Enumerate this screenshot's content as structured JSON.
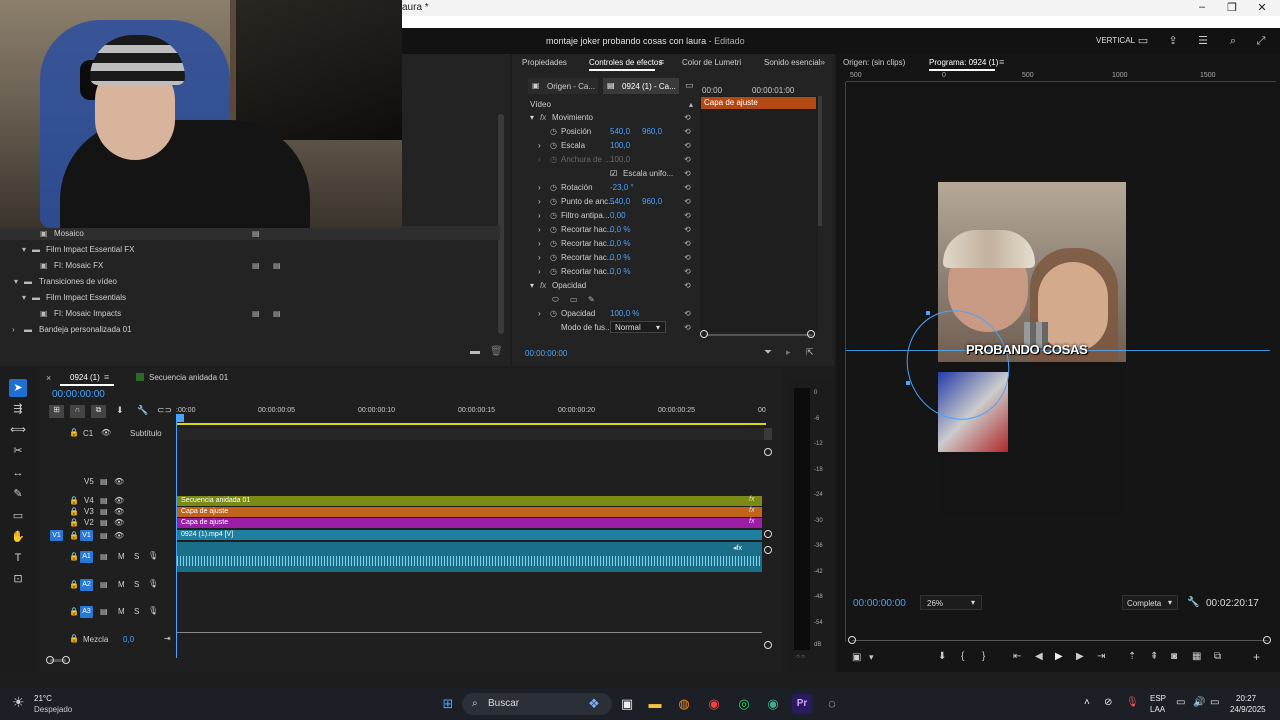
{
  "window": {
    "title_fragment": "aura *"
  },
  "header": {
    "project_title": "montaje joker probando cosas con laura",
    "edited_suffix": " - Editado",
    "workspace": "VERTICAL"
  },
  "bin": {
    "items": [
      {
        "label": "Mosaico",
        "icon": "effect-icon"
      },
      {
        "label": "Film Impact Essential FX",
        "icon": "folder-icon"
      },
      {
        "label": "FI: Mosaic FX",
        "icon": "effect-icon"
      },
      {
        "label": "Transiciones de vídeo",
        "icon": "folder-icon"
      },
      {
        "label": "Film Impact Essentials",
        "icon": "folder-icon"
      },
      {
        "label": "FI: Mosaic Impacts",
        "icon": "effect-icon"
      },
      {
        "label": "Bandeja personalizada 01",
        "icon": "folder-icon"
      }
    ]
  },
  "effects": {
    "tabs": [
      "Propiedades",
      "Controles de efectos",
      "Color de Lumetri",
      "Sonido esencial"
    ],
    "source_tab": "Origen - Ca...",
    "seq_tab": "0924 (1) - Ca...",
    "tc_start": "00:00",
    "tc_end": "00:00:01:00",
    "clip_label": "Capa de ajuste",
    "section_video": "Vídeo",
    "rows": {
      "movement": "Movimiento",
      "position": "Posición",
      "position_x": "540,0",
      "position_y": "960,0",
      "scale": "Escala",
      "scale_v": "100,0",
      "width": "Anchura de ...",
      "width_v": "100,0",
      "uniform": "Escala unifo...",
      "rotation": "Rotación",
      "rotation_v": "-23,0 °",
      "anchor": "Punto de anc...",
      "anchor_x": "540,0",
      "anchor_y": "960,0",
      "flicker": "Filtro antipa...",
      "flicker_v": "0,00",
      "crop1": "Recortar hac...",
      "crop1_v": "0,0 %",
      "crop2": "Recortar hac...",
      "crop2_v": "0,0 %",
      "crop3": "Recortar hac...",
      "crop3_v": "0,0 %",
      "crop4": "Recortar hac...",
      "crop4_v": "0,0 %",
      "opacity_section": "Opacidad",
      "opacity": "Opacidad",
      "opacity_v": "100,0 %",
      "blend": "Modo de fus...",
      "blend_v": "Normal"
    },
    "footer_tc": "00:00:00:00"
  },
  "monitor": {
    "source_tab": "Origen: (sin clips)",
    "program_tab": "Programa: 0924 (1)",
    "ruler": [
      "500",
      "0",
      "500",
      "1000",
      "1500"
    ],
    "caption": "PROBANDO COSAS",
    "timecode": "00:00:00:00",
    "zoom": "26%",
    "quality": "Completa",
    "duration": "00:02:20:17"
  },
  "timeline": {
    "tabs": [
      "0924 (1)",
      "Secuencia anidada 01"
    ],
    "timecode": "00:00:00:00",
    "ruler": [
      ":00:00",
      "00:00:00:05",
      "00:00:00:10",
      "00:00:00:15",
      "00:00:00:20",
      "00:00:00:25",
      "00"
    ],
    "subtitle_track": {
      "code": "C1",
      "label": "Subtítulo"
    },
    "video_tracks": [
      "V5",
      "V4",
      "V3",
      "V2",
      "V1"
    ],
    "audio_tracks": [
      "A1",
      "A2",
      "A3"
    ],
    "mix_label": "Mezcla",
    "mix_value": "0,0",
    "clips": [
      {
        "label": "Secuencia anidada 01",
        "color": "#7a8a14"
      },
      {
        "label": "Capa de ajuste",
        "color": "#c0641c"
      },
      {
        "label": "Capa de ajuste",
        "color": "#9a1ea6"
      },
      {
        "label": "0924 (1).mp4 [V]",
        "color": "#1f7fa0"
      }
    ],
    "meter_scale": [
      "0",
      "-6",
      "-12",
      "-18",
      "-24",
      "-30",
      "-36",
      "-42",
      "-48",
      "-54",
      "dB"
    ]
  },
  "taskbar": {
    "weather_temp": "21°C",
    "weather_text": "Despejado",
    "search": "Buscar",
    "lang1": "ESP",
    "lang2": "LAA",
    "time": "20:27",
    "date": "24/9/2025"
  }
}
